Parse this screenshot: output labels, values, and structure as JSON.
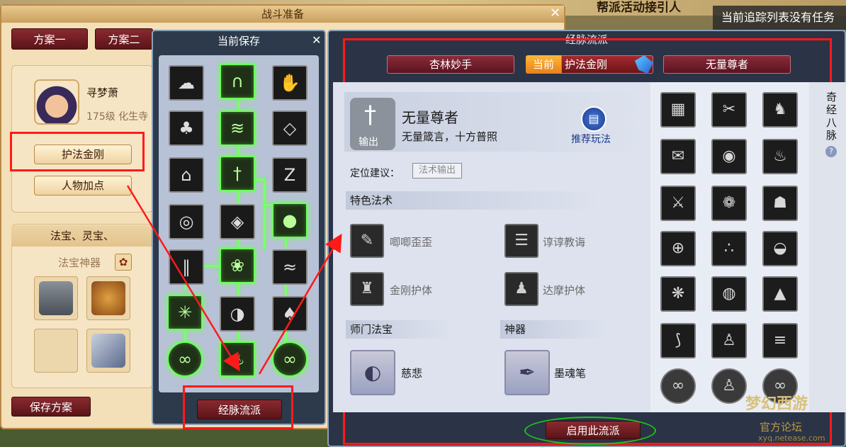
{
  "top_banner": "帮派活动接引人",
  "tracker": "当前追踪列表没有任务",
  "battle_prep": {
    "title": "战斗准备",
    "close": "✕",
    "plan_tabs": [
      "方案一",
      "方案二"
    ],
    "character": {
      "name": "寻梦萧",
      "level": "175级 化生寺"
    },
    "route_button": "护法金刚",
    "attr_button": "人物加点",
    "treasure_header": "法宝、灵宝、",
    "fabao_label": "法宝神器",
    "save_plan": "保存方案"
  },
  "current_save": {
    "title": "当前保存",
    "close": "✕",
    "lineage_button": "经脉流派"
  },
  "lineage": {
    "title": "经脉流派",
    "tabs": [
      "杏林妙手",
      "护法金刚",
      "无量尊者"
    ],
    "current_badge": "当前",
    "route_name": "无量尊者",
    "route_motto": "无量箴言，十方普照",
    "role_tag": "输出",
    "recommend": "推荐玩法",
    "position_label": "定位建议：",
    "position_value": "法术输出",
    "special_spells_header": "特色法术",
    "spells": [
      "唧唧歪歪",
      "谆谆教诲",
      "金刚护体",
      "达摩护体"
    ],
    "school_treasure_header": "师门法宝",
    "artifact_header": "神器",
    "school_treasure": "慈悲",
    "artifact": "墨魂笔",
    "side_text": "奇经八脉",
    "help": "?",
    "enable_button": "启用此流派"
  },
  "watermark": {
    "logo": "梦幻西游",
    "forum": "官方论坛",
    "url": "xyq.netease.com"
  },
  "colors": {
    "highlight_red": "#ff1a1a",
    "highlight_green": "#1ec81e",
    "node_glow": "#6cff5c"
  }
}
